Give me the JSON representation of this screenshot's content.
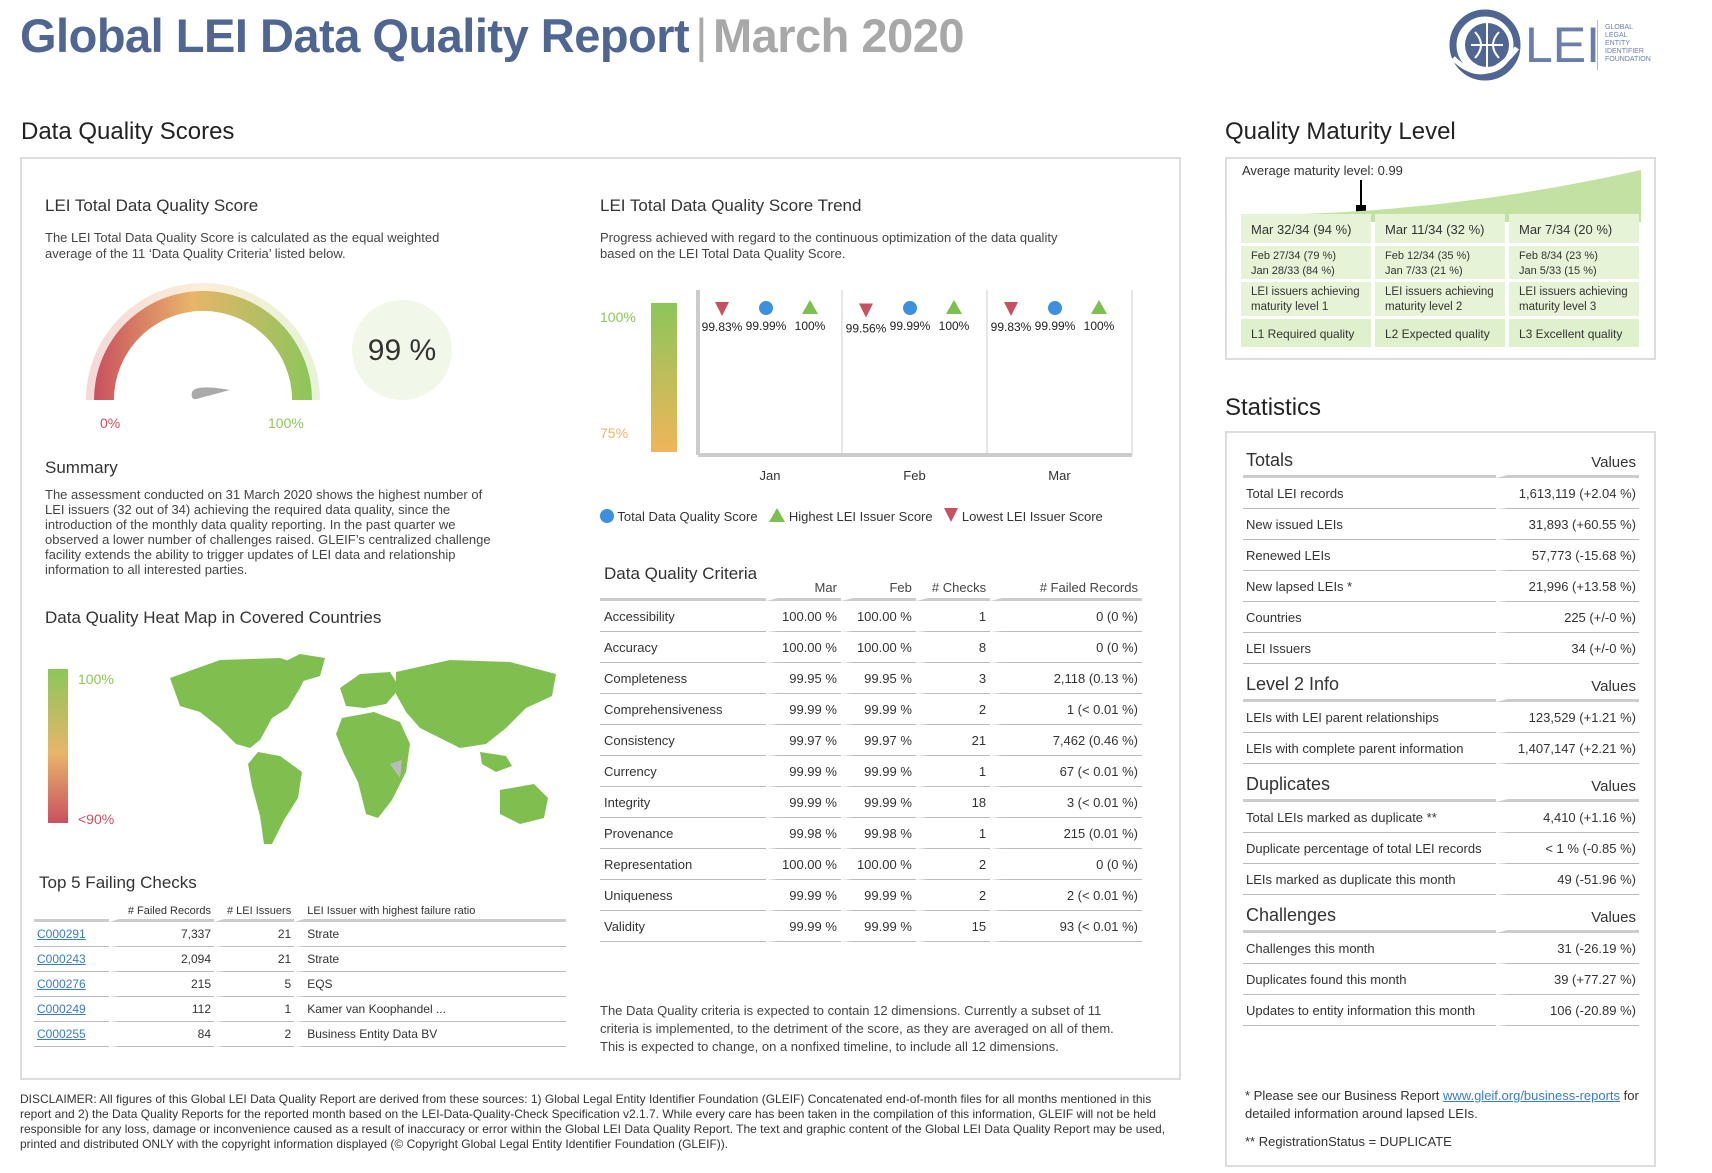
{
  "header": {
    "title": "Global LEI Data Quality Report",
    "separator": "|",
    "month": "March 2020",
    "logo_text": "LEI",
    "logo_sub": [
      "GLOBAL",
      "LEGAL",
      "ENTITY",
      "IDENTIFIER",
      "FOUNDATION"
    ]
  },
  "dq": {
    "section_title": "Data Quality Scores",
    "total": {
      "title": "LEI Total Data Quality Score",
      "desc": "The LEI Total Data Quality Score is calculated as the equal weighted average of the 11 ‘Data Quality Criteria’ listed below.",
      "score": "99 %",
      "score_value": 99,
      "gauge_min": "0%",
      "gauge_max": "100%"
    },
    "summary": {
      "title": "Summary",
      "text": "The assessment conducted on 31 March 2020 shows the highest number of LEI issuers (32 out of 34) achieving the required data quality, since the introduction of the monthly data quality reporting. In the past quarter we observed a lower number of challenges raised. GLEIF’s centralized challenge facility extends the ability to trigger updates of LEI data and relationship information to all interested parties."
    },
    "heatmap": {
      "title": "Data Quality Heat Map in Covered Countries",
      "max_label": "100%",
      "min_label": "<90%"
    },
    "top5": {
      "title": "Top 5 Failing Checks",
      "headers": [
        "# Failed Records",
        "# LEI Issuers",
        "LEI Issuer with highest failure ratio"
      ],
      "rows": [
        {
          "id": "C000291",
          "failed": "7,337",
          "issuers": "21",
          "issuer": "Strate"
        },
        {
          "id": "C000243",
          "failed": "2,094",
          "issuers": "21",
          "issuer": "Strate"
        },
        {
          "id": "C000276",
          "failed": "215",
          "issuers": "5",
          "issuer": "EQS"
        },
        {
          "id": "C000249",
          "failed": "112",
          "issuers": "1",
          "issuer": "Kamer van Koophandel ..."
        },
        {
          "id": "C000255",
          "failed": "84",
          "issuers": "2",
          "issuer": "Business Entity Data BV"
        }
      ]
    },
    "trend": {
      "title": "LEI Total Data Quality Score Trend",
      "desc": "Progress achieved with regard to the continuous optimization of the data quality based on the LEI Total Data Quality Score.",
      "y_top": "100%",
      "y_bottom": "75%",
      "legend": {
        "total": "Total Data Quality Score",
        "highest": "Highest LEI Issuer Score",
        "lowest": "Lowest LEI Issuer Score"
      }
    },
    "criteria": {
      "title": "Data Quality Criteria",
      "headers": [
        "Mar",
        "Feb",
        "# Checks",
        "# Failed Records"
      ],
      "rows": [
        {
          "name": "Accessibility",
          "mar": "100.00 %",
          "feb": "100.00 %",
          "checks": "1",
          "failed": "0 (0 %)"
        },
        {
          "name": "Accuracy",
          "mar": "100.00 %",
          "feb": "100.00 %",
          "checks": "8",
          "failed": "0 (0 %)"
        },
        {
          "name": "Completeness",
          "mar": "99.95 %",
          "feb": "99.95 %",
          "checks": "3",
          "failed": "2,118 (0.13 %)"
        },
        {
          "name": "Comprehensiveness",
          "mar": "99.99 %",
          "feb": "99.99 %",
          "checks": "2",
          "failed": "1 (< 0.01 %)"
        },
        {
          "name": "Consistency",
          "mar": "99.97 %",
          "feb": "99.97 %",
          "checks": "21",
          "failed": "7,462 (0.46 %)"
        },
        {
          "name": "Currency",
          "mar": "99.99 %",
          "feb": "99.99 %",
          "checks": "1",
          "failed": "67 (< 0.01 %)"
        },
        {
          "name": "Integrity",
          "mar": "99.99 %",
          "feb": "99.99 %",
          "checks": "18",
          "failed": "3 (< 0.01 %)"
        },
        {
          "name": "Provenance",
          "mar": "99.98 %",
          "feb": "99.98 %",
          "checks": "1",
          "failed": "215 (0.01 %)"
        },
        {
          "name": "Representation",
          "mar": "100.00 %",
          "feb": "100.00 %",
          "checks": "2",
          "failed": "0 (0 %)"
        },
        {
          "name": "Uniqueness",
          "mar": "99.99 %",
          "feb": "99.99 %",
          "checks": "2",
          "failed": "2 (< 0.01 %)"
        },
        {
          "name": "Validity",
          "mar": "99.99 %",
          "feb": "99.99 %",
          "checks": "15",
          "failed": "93 (< 0.01 %)"
        }
      ],
      "note": "The Data Quality criteria is expected to contain 12 dimensions. Currently a subset of 11 criteria is implemented, to the detriment of the score, as they are averaged on all of them. This is expected to change, on a nonfixed timeline, to include all 12 dimensions."
    }
  },
  "chart_data": {
    "type": "scatter",
    "title": "LEI Total Data Quality Score Trend",
    "categories": [
      "Jan",
      "Feb",
      "Mar"
    ],
    "ylim": [
      75,
      100
    ],
    "series": [
      {
        "name": "Lowest LEI Issuer Score",
        "marker": "triangle-down",
        "color": "#c9505f",
        "values": [
          99.83,
          99.56,
          99.83
        ],
        "labels": [
          "99.83%",
          "99.56%",
          "99.83%"
        ]
      },
      {
        "name": "Total Data Quality Score",
        "marker": "circle",
        "color": "#3d8fe0",
        "values": [
          99.99,
          99.99,
          99.99
        ],
        "labels": [
          "99.99%",
          "99.99%",
          "99.99%"
        ]
      },
      {
        "name": "Highest LEI Issuer Score",
        "marker": "triangle-up",
        "color": "#7cc04f",
        "values": [
          100,
          100,
          100
        ],
        "labels": [
          "100%",
          "100%",
          "100%"
        ]
      }
    ]
  },
  "maturity": {
    "section_title": "Quality Maturity Level",
    "average": "Average maturity level: 0.99",
    "levels": [
      {
        "head": "Mar 32/34 (94 %)",
        "hist1": "Feb 27/34 (79 %)",
        "hist2": "Jan 28/33 (84 %)",
        "desc1": "LEI issuers achieving",
        "desc2": "maturity level 1",
        "label": "L1 Required quality"
      },
      {
        "head": "Mar 11/34 (32 %)",
        "hist1": "Feb 12/34 (35 %)",
        "hist2": "Jan 7/33 (21 %)",
        "desc1": "LEI issuers achieving",
        "desc2": "maturity level 2",
        "label": "L2 Expected quality"
      },
      {
        "head": "Mar 7/34 (20 %)",
        "hist1": "Feb 8/34 (23 %)",
        "hist2": "Jan 5/33 (15 %)",
        "desc1": "LEI issuers achieving",
        "desc2": "maturity level 3",
        "label": "L3 Excellent quality"
      }
    ]
  },
  "stats": {
    "section_title": "Statistics",
    "values_label": "Values",
    "groups": [
      {
        "title": "Totals",
        "rows": [
          {
            "k": "Total LEI records",
            "v": "1,613,119 (+2.04 %)"
          },
          {
            "k": "New issued LEIs",
            "v": "31,893 (+60.55 %)"
          },
          {
            "k": "Renewed LEIs",
            "v": "57,773 (-15.68 %)"
          },
          {
            "k": "New lapsed LEIs *",
            "v": "21,996 (+13.58 %)"
          },
          {
            "k": "Countries",
            "v": "225 (+/-0 %)"
          },
          {
            "k": "LEI Issuers",
            "v": "34 (+/-0 %)"
          }
        ]
      },
      {
        "title": "Level 2 Info",
        "rows": [
          {
            "k": "LEIs with LEI parent relationships",
            "v": "123,529 (+1.21 %)"
          },
          {
            "k": "LEIs with complete parent information",
            "v": "1,407,147 (+2.21 %)"
          }
        ]
      },
      {
        "title": "Duplicates",
        "rows": [
          {
            "k": "Total LEIs marked as duplicate **",
            "v": "4,410 (+1.16 %)"
          },
          {
            "k": "Duplicate percentage of total LEI records",
            "v": "< 1 % (-0.85 %)"
          },
          {
            "k": "LEIs marked as duplicate this month",
            "v": "49 (-51.96 %)"
          }
        ]
      },
      {
        "title": "Challenges",
        "rows": [
          {
            "k": "Challenges this month",
            "v": "31 (-26.19 %)"
          },
          {
            "k": "Duplicates found this month",
            "v": "39 (+77.27 %)"
          },
          {
            "k": "Updates to entity information this month",
            "v": "106 (-20.89 %)"
          }
        ]
      }
    ],
    "foot1_pre": "* Please see our Business Report",
    "foot1_link": "www.gleif.org/business-reports",
    "foot1_post": "for detailed information around lapsed LEIs.",
    "foot2": "** RegistrationStatus = DUPLICATE"
  },
  "disclaimer": "DISCLAIMER: All figures of this Global LEI Data Quality Report are derived from these sources: 1) Global Legal Entity Identifier Foundation (GLEIF) Concatenated end-of-month files for all months mentioned in this report and 2) the Data Quality Reports for the reported month based on the LEI-Data-Quality-Check Specification v2.1.7. While every care has been taken in the compilation of this information, GLEIF will not be held responsible for any loss, damage or inconvenience caused as a result of inaccuracy or error within the Global LEI Data Quality Report. The text and graphic content of the Global LEI Data Quality Report may be used, printed and distributed ONLY with the copyright information displayed (© Copyright Global Legal Entity Identifier Foundation (GLEIF))."
}
